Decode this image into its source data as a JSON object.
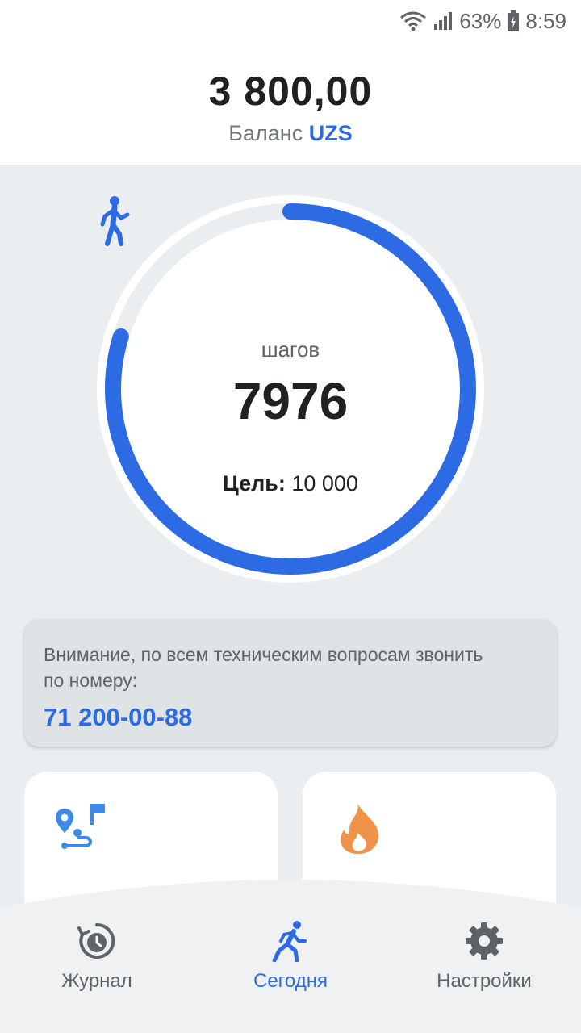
{
  "status_bar": {
    "battery": "63%",
    "time": "8:59"
  },
  "balance": {
    "amount": "3 800,00",
    "label": "Баланс",
    "currency": "UZS"
  },
  "steps": {
    "label": "шагов",
    "count": "7976",
    "goal_label": "Цель:",
    "goal_value": "10 000",
    "progress": 0.7976
  },
  "notice": {
    "text": "Внимание, по всем техническим вопросам звонить по номеру:",
    "phone": "71 200-00-88"
  },
  "cards": [
    {
      "icon": "route-icon"
    },
    {
      "icon": "fire-icon"
    }
  ],
  "nav": {
    "items": [
      {
        "label": "Журнал",
        "icon": "history-icon"
      },
      {
        "label": "Сегодня",
        "icon": "walk-icon",
        "active": true
      },
      {
        "label": "Настройки",
        "icon": "gear-icon"
      }
    ]
  },
  "colors": {
    "accent": "#2d6be4",
    "ring_track": "#ebeef1",
    "fire": "#f0924a"
  }
}
